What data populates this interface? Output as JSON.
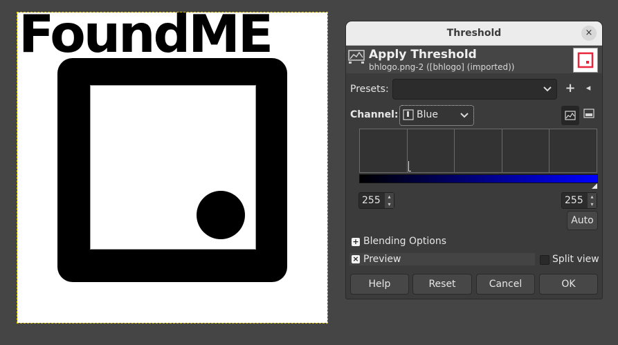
{
  "canvas": {
    "logo_text": "FoundME"
  },
  "dialog": {
    "title": "Threshold",
    "close_glyph": "×",
    "header": {
      "title": "Apply Threshold",
      "subtitle": "bhlogo.png-2 ([bhlogo] (imported))",
      "icon": "threshold-icon"
    },
    "presets": {
      "label": "Presets:",
      "value": "",
      "add_glyph": "+",
      "menu_glyph": "◂"
    },
    "channel": {
      "label": "Channel:",
      "value": "Blue",
      "linear_icon": "linear-histogram-icon",
      "log_icon": "log-histogram-icon"
    },
    "histogram": {
      "low_value": "255",
      "high_value": "255",
      "gradient_start": "#000000",
      "gradient_end": "#0000ff"
    },
    "auto_label": "Auto",
    "blending_options_label": "Blending Options",
    "preview_label": "Preview",
    "preview_checked": true,
    "split_view_label": "Split view",
    "split_view_checked": false,
    "buttons": {
      "help": "Help",
      "reset": "Reset",
      "cancel": "Cancel",
      "ok": "OK"
    }
  }
}
